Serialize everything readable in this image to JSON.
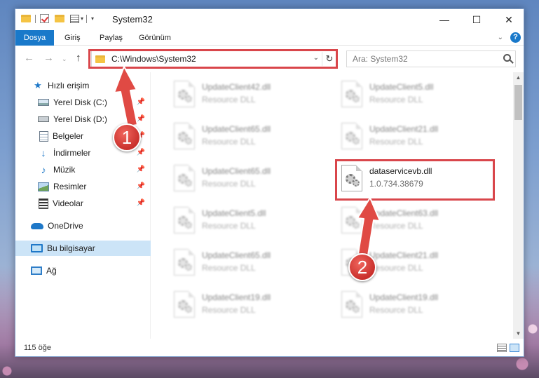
{
  "window": {
    "title": "System32",
    "controls": {
      "minimize": "—",
      "maximize": "☐",
      "close": "✕"
    }
  },
  "ribbon": {
    "tabs": [
      "Dosya",
      "Giriş",
      "Paylaş",
      "Görünüm"
    ]
  },
  "nav": {
    "address": "C:\\Windows\\System32",
    "search_placeholder": "Ara: System32"
  },
  "sidebar": {
    "items": [
      {
        "label": "Hızlı erişim",
        "icon": "star-icon"
      },
      {
        "label": "Yerel Disk (C:)",
        "icon": "drive-icon",
        "pinned": true
      },
      {
        "label": "Yerel Disk (D:)",
        "icon": "drive-icon",
        "pinned": true
      },
      {
        "label": "Belgeler",
        "icon": "documents-icon",
        "pinned": true
      },
      {
        "label": "İndirmeler",
        "icon": "downloads-icon",
        "pinned": true
      },
      {
        "label": "Müzik",
        "icon": "music-icon",
        "pinned": true
      },
      {
        "label": "Resimler",
        "icon": "pictures-icon",
        "pinned": true
      },
      {
        "label": "Videolar",
        "icon": "videos-icon",
        "pinned": true
      },
      {
        "label": "OneDrive",
        "icon": "cloud-icon"
      },
      {
        "label": "Bu bilgisayar",
        "icon": "computer-icon",
        "selected": true
      },
      {
        "label": "Ağ",
        "icon": "network-icon"
      }
    ]
  },
  "files": [
    {
      "name": "UpdateClient42.dll",
      "type": "Resource DLL"
    },
    {
      "name": "UpdateClient5.dll",
      "type": "Resource DLL"
    },
    {
      "name": "UpdateClient65.dll",
      "type": "Resource DLL"
    },
    {
      "name": "UpdateClient21.dll",
      "type": "Resource DLL"
    },
    {
      "name": "UpdateClient65.dll",
      "type": "Resource DLL"
    },
    {
      "name": "dataservicevb.dll",
      "type": "1.0.734.38679"
    },
    {
      "name": "UpdateClient5.dll",
      "type": "Resource DLL"
    },
    {
      "name": "UpdateClient63.dll",
      "type": "Resource DLL"
    },
    {
      "name": "UpdateClient65.dll",
      "type": "Resource DLL"
    },
    {
      "name": "UpdateClient21.dll",
      "type": "Resource DLL"
    },
    {
      "name": "UpdateClient19.dll",
      "type": "Resource DLL"
    },
    {
      "name": "UpdateClient19.dll",
      "type": "Resource DLL"
    }
  ],
  "status": {
    "count": "115 öğe"
  },
  "annotations": {
    "step1": "1",
    "step2": "2",
    "color": "#d9464b"
  }
}
